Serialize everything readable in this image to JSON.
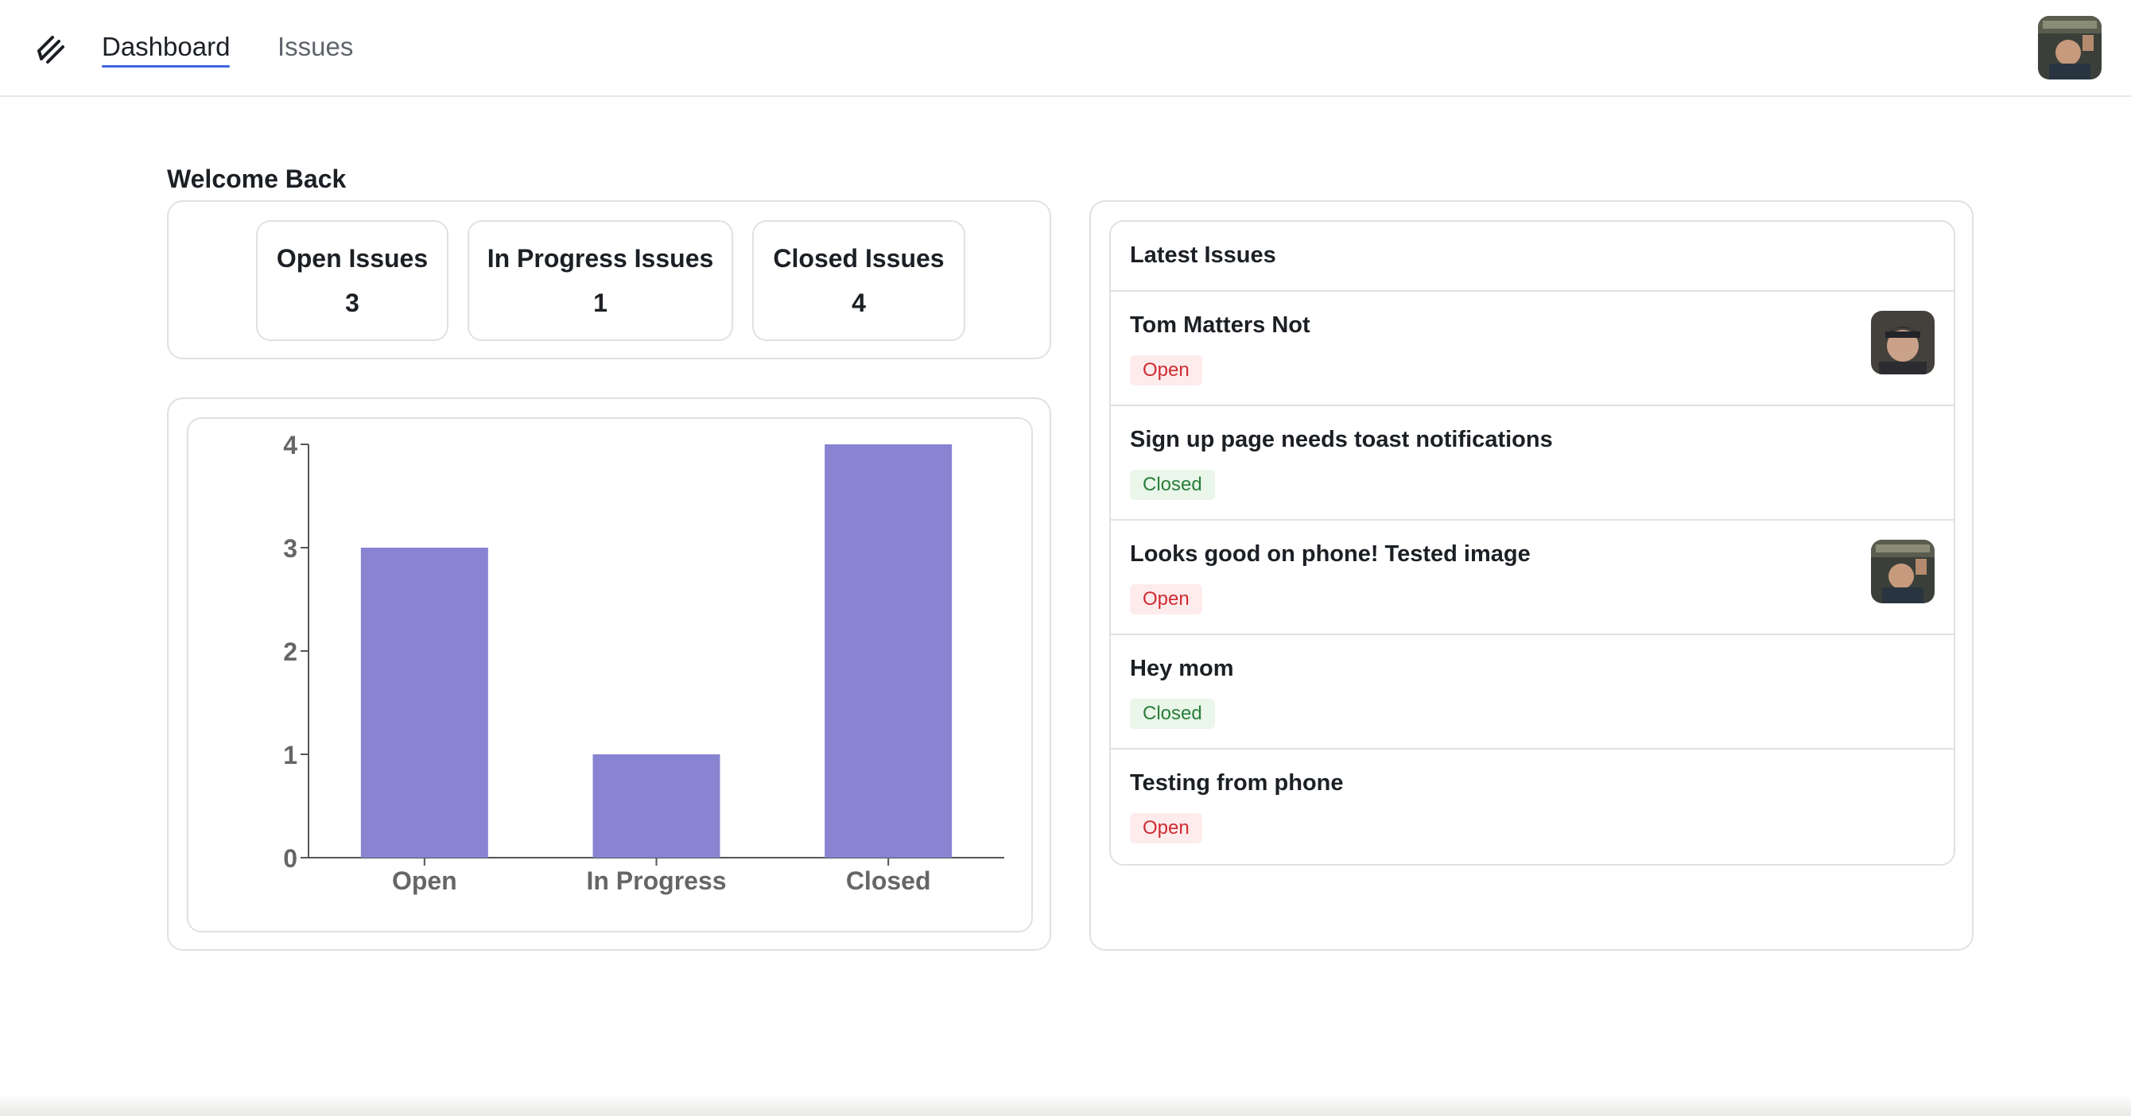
{
  "nav": {
    "logo_icon": "bug-logo-icon",
    "links": [
      {
        "label": "Dashboard",
        "active": true
      },
      {
        "label": "Issues",
        "active": false
      }
    ],
    "avatar": "user-avatar"
  },
  "welcome": "Welcome Back",
  "stats": [
    {
      "label": "Open Issues",
      "value": "3"
    },
    {
      "label": "In Progress Issues",
      "value": "1"
    },
    {
      "label": "Closed Issues",
      "value": "4"
    }
  ],
  "chart_data": {
    "type": "bar",
    "categories": [
      "Open",
      "In Progress",
      "Closed"
    ],
    "values": [
      3,
      1,
      4
    ],
    "ylim": [
      0,
      4
    ],
    "yticks": [
      "0",
      "1",
      "2",
      "3",
      "4"
    ],
    "bar_color": "#8884d2",
    "grid": false
  },
  "latest_issues": {
    "title": "Latest Issues",
    "items": [
      {
        "title": "Tom Matters Not",
        "status": "Open",
        "has_avatar": true
      },
      {
        "title": "Sign up page needs toast notifications",
        "status": "Closed",
        "has_avatar": false
      },
      {
        "title": "Looks good on phone! Tested image",
        "status": "Open",
        "has_avatar": true
      },
      {
        "title": "Hey mom",
        "status": "Closed",
        "has_avatar": false
      },
      {
        "title": "Testing from phone",
        "status": "Open",
        "has_avatar": false
      }
    ]
  },
  "colors": {
    "accent": "#3e63dd",
    "open_bg": "#feebec",
    "open_text": "#ce2c31",
    "closed_bg": "#e9f6e9",
    "closed_text": "#2a7e3b"
  }
}
